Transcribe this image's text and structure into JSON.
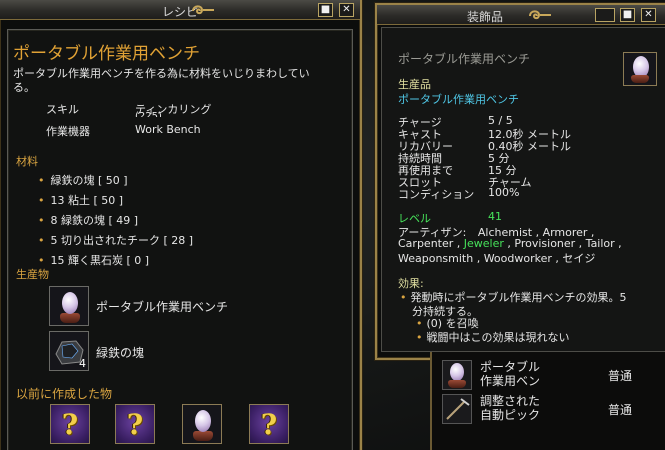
{
  "recipe": {
    "title": "レシピ",
    "name": "ポータブル作業用ベンチ",
    "description_line1": "ポータブル作業用ベンチを作る為に材料をいじりまわしてい",
    "description_line2": "る。",
    "skill_label": "スキル",
    "skill_value": "ティンカリング",
    "skill_value_sub": "(225)",
    "device_label": "作業機器",
    "device_value": "Work Bench",
    "materials_header": "材料",
    "materials": [
      "緑鉄の塊 [ 50 ]",
      "13 粘土 [ 50 ]",
      "8 緑鉄の塊 [ 49 ]",
      "5 切り出されたチーク [ 28 ]",
      "15 輝く黒石炭 [ 0 ]"
    ],
    "products_header": "生産物",
    "products": [
      {
        "name": "ポータブル作業用ベンチ",
        "icon": "workbench-egg-icon"
      },
      {
        "name": "緑鉄の塊",
        "icon": "iron-lump-icon",
        "count": "4"
      }
    ],
    "previous_header": "以前に作成した物",
    "previous_items": [
      "?",
      "?",
      "workbench",
      "?"
    ]
  },
  "ornament": {
    "title": "装飾品",
    "item_name": "ポータブル作業用ベンチ",
    "category": "生産品",
    "category_item": "ポータブル作業用ベンチ",
    "stats": [
      {
        "label": "チャージ",
        "value": "5 / 5"
      },
      {
        "label": "キャスト",
        "value": "12.0秒 メートル"
      },
      {
        "label": "リカバリー",
        "value": "0.40秒 メートル"
      },
      {
        "label": "持続時間",
        "value": "5 分"
      },
      {
        "label": "再使用まで",
        "value": "15 分"
      },
      {
        "label": "スロット",
        "value": "チャーム"
      },
      {
        "label": "コンディション",
        "value": "100%"
      }
    ],
    "level_label": "レベル",
    "level_value": "41",
    "adventurer_label": "アーティザン:",
    "classes_line1": "Alchemist , Armorer ,",
    "classes_line2a": "Carpenter ,",
    "classes_line2_hl": "Jeweler",
    "classes_line2b": ", Provisioner , Tailor ,",
    "classes_line3": "Weaponsmith , Woodworker , セイジ",
    "effect_header": "効果:",
    "effect_line1": "発動時にポータブル作業用ベンチの効果。5",
    "effect_line2": "分持続する。",
    "effect_sub1": "(0) を召喚",
    "effect_sub2": "戦闘中はこの効果は現れない"
  },
  "list": [
    {
      "name_line1": "ポータブル",
      "name_line2": "作業用ベン",
      "quality": "普通"
    },
    {
      "name_line1": "調整された",
      "name_line2": "自動ピック",
      "quality": "普通"
    }
  ],
  "buttons": {
    "pin": "■",
    "close": "✕"
  }
}
